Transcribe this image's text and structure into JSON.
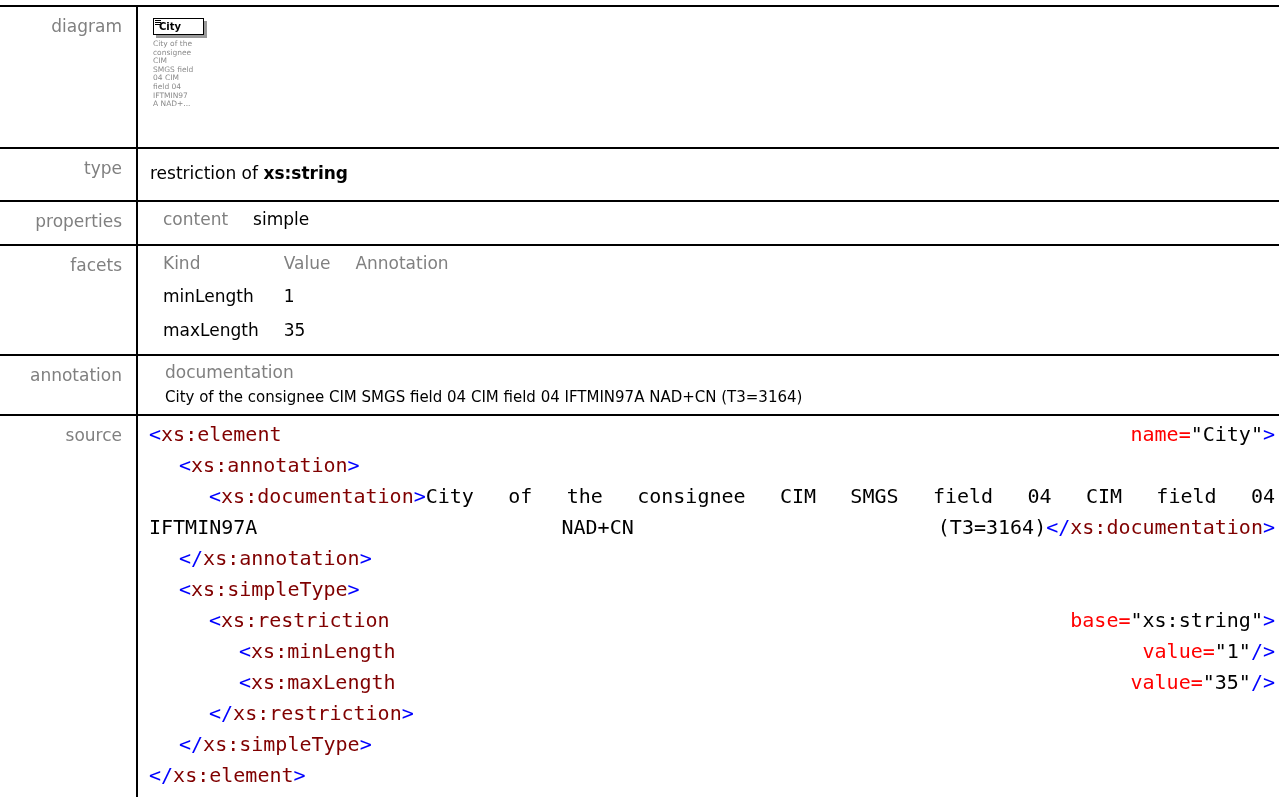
{
  "rows": [
    {
      "kind": "diagram",
      "label": "diagram",
      "element": "City",
      "caption": [
        "City of the",
        "consignee",
        "CIM",
        "SMGS field",
        "04 CIM",
        "field 04",
        "IFTMIN97",
        "A NAD+..."
      ]
    },
    {
      "kind": "text",
      "label": "type",
      "text": "restriction of **xs:string**"
    },
    {
      "kind": "grid",
      "label": "properties",
      "header": [
        "content",
        "simple"
      ],
      "body": []
    },
    {
      "kind": "grid",
      "label": "facets",
      "header": [
        "Kind",
        "Value",
        "Annotation"
      ],
      "body": [
        [
          "minLength",
          "1"
        ],
        [
          "maxLength",
          "35"
        ]
      ]
    },
    {
      "kind": "annotation",
      "label": "annotation",
      "heading": "documentation",
      "text": "City of the consignee CIM SMGS field 04 CIM field 04 IFTMIN97A NAD+CN (T3=3164)"
    },
    {
      "kind": "source",
      "label": "source",
      "lines": [
        {
          "words": [
            [
              {
                "kind": "bracket",
                "text": "<"
              },
              {
                "kind": "tag",
                "text": "xs:element"
              }
            ],
            [
              {
                "kind": "attr",
                "text": "name="
              },
              {
                "kind": "value",
                "text": "\"City\""
              },
              {
                "kind": "bracket",
                "text": ">"
              }
            ]
          ],
          "children": [
            {
              "words": [
                [
                  {
                    "kind": "bracket",
                    "text": "<"
                  },
                  {
                    "kind": "tag",
                    "text": "xs:annotation"
                  },
                  {
                    "kind": "bracket",
                    "text": ">"
                  }
                ]
              ],
              "children": [
                {
                  "words": [
                    [
                      {
                        "kind": "bracket",
                        "text": "<"
                      },
                      {
                        "kind": "tag",
                        "text": "xs:documentation"
                      },
                      {
                        "kind": "bracket",
                        "text": ">"
                      },
                      {
                        "kind": "value",
                        "text": "City"
                      }
                    ],
                    [
                      {
                        "kind": "value",
                        "text": "of"
                      }
                    ],
                    [
                      {
                        "kind": "value",
                        "text": "the"
                      }
                    ],
                    [
                      {
                        "kind": "value",
                        "text": "consignee"
                      }
                    ],
                    [
                      {
                        "kind": "value",
                        "text": "CIM"
                      }
                    ],
                    [
                      {
                        "kind": "value",
                        "text": "SMGS"
                      }
                    ],
                    [
                      {
                        "kind": "value",
                        "text": "field"
                      }
                    ],
                    [
                      {
                        "kind": "value",
                        "text": "04"
                      }
                    ],
                    [
                      {
                        "kind": "value",
                        "text": "CIM"
                      }
                    ],
                    [
                      {
                        "kind": "value",
                        "text": "field"
                      }
                    ],
                    [
                      {
                        "kind": "value",
                        "text": "04"
                      }
                    ]
                  ],
                  "wrap": {
                    "words": [
                      [
                        {
                          "kind": "value",
                          "text": "IFTMIN97A"
                        }
                      ],
                      [
                        {
                          "kind": "value",
                          "text": "NAD+CN"
                        }
                      ],
                      [
                        {
                          "kind": "value",
                          "text": "(T3=3164)"
                        },
                        {
                          "kind": "bracket",
                          "text": "</"
                        },
                        {
                          "kind": "tag",
                          "text": "xs:documentation"
                        },
                        {
                          "kind": "bracket",
                          "text": ">"
                        }
                      ]
                    ]
                  }
                }
              ]
            },
            {
              "words": [
                [
                  {
                    "kind": "bracket",
                    "text": "</"
                  },
                  {
                    "kind": "tag",
                    "text": "xs:annotation"
                  },
                  {
                    "kind": "bracket",
                    "text": ">"
                  }
                ]
              ]
            },
            {
              "words": [
                [
                  {
                    "kind": "bracket",
                    "text": "<"
                  },
                  {
                    "kind": "tag",
                    "text": "xs:simpleType"
                  },
                  {
                    "kind": "bracket",
                    "text": ">"
                  }
                ]
              ],
              "children": [
                {
                  "words": [
                    [
                      {
                        "kind": "bracket",
                        "text": "<"
                      },
                      {
                        "kind": "tag",
                        "text": "xs:restriction"
                      }
                    ],
                    [
                      {
                        "kind": "attr",
                        "text": "base="
                      },
                      {
                        "kind": "value",
                        "text": "\"xs:string\""
                      },
                      {
                        "kind": "bracket",
                        "text": ">"
                      }
                    ]
                  ],
                  "children": [
                    {
                      "words": [
                        [
                          {
                            "kind": "bracket",
                            "text": "<"
                          },
                          {
                            "kind": "tag",
                            "text": "xs:minLength"
                          }
                        ],
                        [
                          {
                            "kind": "attr",
                            "text": "value="
                          },
                          {
                            "kind": "value",
                            "text": "\"1\""
                          },
                          {
                            "kind": "bracket",
                            "text": "/>"
                          }
                        ]
                      ]
                    },
                    {
                      "words": [
                        [
                          {
                            "kind": "bracket",
                            "text": "<"
                          },
                          {
                            "kind": "tag",
                            "text": "xs:maxLength"
                          }
                        ],
                        [
                          {
                            "kind": "attr",
                            "text": "value="
                          },
                          {
                            "kind": "value",
                            "text": "\"35\""
                          },
                          {
                            "kind": "bracket",
                            "text": "/>"
                          }
                        ]
                      ]
                    }
                  ]
                },
                {
                  "words": [
                    [
                      {
                        "kind": "bracket",
                        "text": "</"
                      },
                      {
                        "kind": "tag",
                        "text": "xs:restriction"
                      },
                      {
                        "kind": "bracket",
                        "text": ">"
                      }
                    ]
                  ]
                }
              ]
            },
            {
              "words": [
                [
                  {
                    "kind": "bracket",
                    "text": "</"
                  },
                  {
                    "kind": "tag",
                    "text": "xs:simpleType"
                  },
                  {
                    "kind": "bracket",
                    "text": ">"
                  }
                ]
              ]
            }
          ]
        },
        {
          "words": [
            [
              {
                "kind": "bracket",
                "text": "</"
              },
              {
                "kind": "tag",
                "text": "xs:element"
              },
              {
                "kind": "bracket",
                "text": ">"
              }
            ]
          ]
        }
      ]
    }
  ]
}
